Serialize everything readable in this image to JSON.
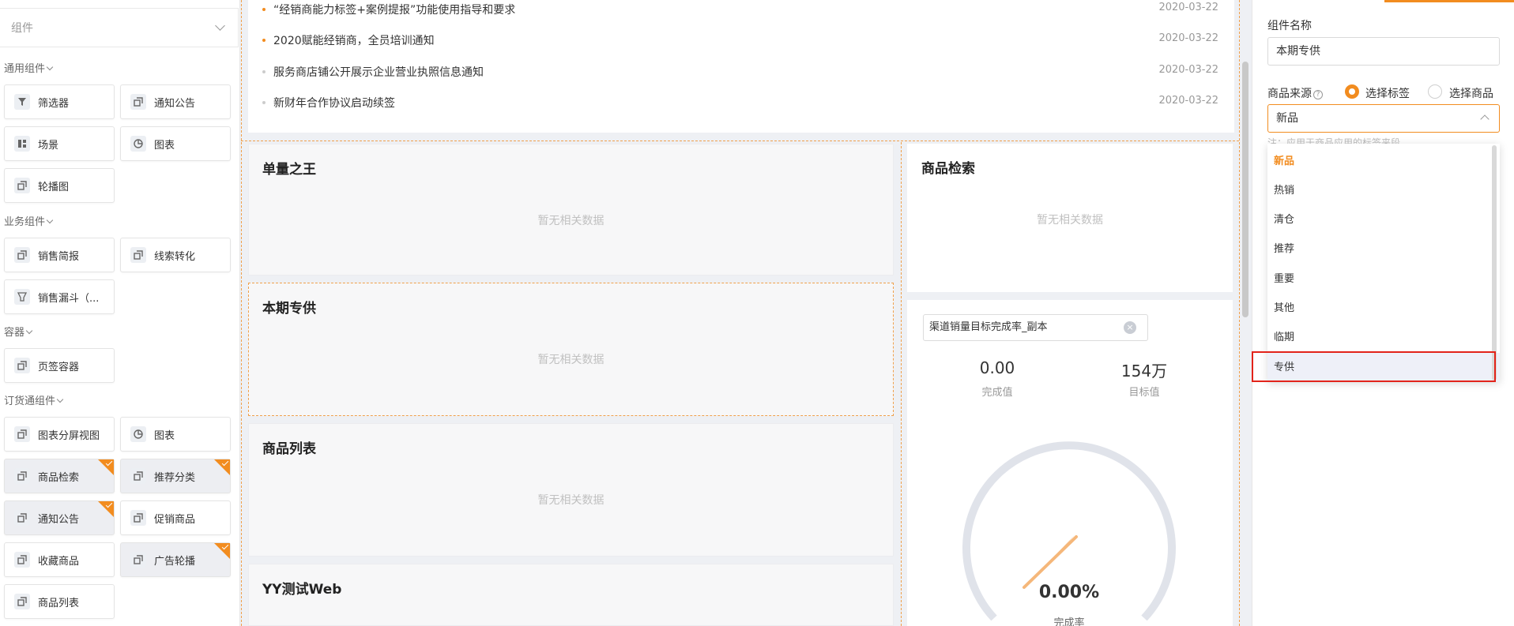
{
  "left_panel": {
    "search_placeholder": "组件",
    "sections": {
      "general": "通用组件",
      "business": "业务组件",
      "container": "容器",
      "ordering": "订货通组件"
    },
    "cards": {
      "filter": "筛选器",
      "notice1": "通知公告",
      "scene": "场景",
      "chart1": "图表",
      "carousel": "轮播图",
      "sales_brief": "销售简报",
      "lead_conv": "线索转化",
      "sales_funnel": "销售漏斗（...",
      "tab_container": "页签容器",
      "chart_split": "图表分屏视图",
      "chart2": "图表",
      "product_search": "商品检索",
      "rec_category": "推荐分类",
      "notice2": "通知公告",
      "promo": "促销商品",
      "favorites": "收藏商品",
      "ad_carousel": "广告轮播",
      "product_list": "商品列表"
    }
  },
  "notices": [
    {
      "title": "“经销商能力标签+案例提报”功能使用指导和要求",
      "date": "2020-03-22",
      "dot": "#f28c1f"
    },
    {
      "title": "2020赋能经销商，全员培训通知",
      "date": "2020-03-22",
      "dot": "#f28c1f"
    },
    {
      "title": "服务商店铺公开展示企业营业执照信息通知",
      "date": "2020-03-22",
      "dot": "#cccccc"
    },
    {
      "title": "新财年合作协议启动续签",
      "date": "2020-03-22",
      "dot": "#cccccc"
    }
  ],
  "blocks": {
    "king": {
      "title": "单量之王",
      "empty": "暂无相关数据"
    },
    "exclusive": {
      "title": "本期专供",
      "empty": "暂无相关数据"
    },
    "plist": {
      "title": "商品列表",
      "empty": "暂无相关数据"
    },
    "yy": {
      "title": "YY测试Web"
    },
    "search": {
      "title": "商品检索",
      "empty": "暂无相关数据"
    }
  },
  "kpi": {
    "select_value": "渠道销量目标完成率_副本",
    "clear_icon": "×",
    "done_value": "0.00",
    "done_label": "完成值",
    "target_value": "154万",
    "target_label": "目标值",
    "gauge_percent": "0.00%",
    "gauge_label": "完成率"
  },
  "right_panel": {
    "name_label": "组件名称",
    "name_value": "本期专供",
    "source_label": "商品来源",
    "help": "?",
    "radio_tag": "选择标签",
    "radio_product": "选择商品",
    "select_value": "新品",
    "hint": "注：应用于商品应用的标签来段",
    "options": [
      "新品",
      "热销",
      "清仓",
      "推荐",
      "重要",
      "其他",
      "临期",
      "专供"
    ]
  },
  "colors": {
    "accent": "#f28c1f",
    "highlight": "#e2231a"
  }
}
